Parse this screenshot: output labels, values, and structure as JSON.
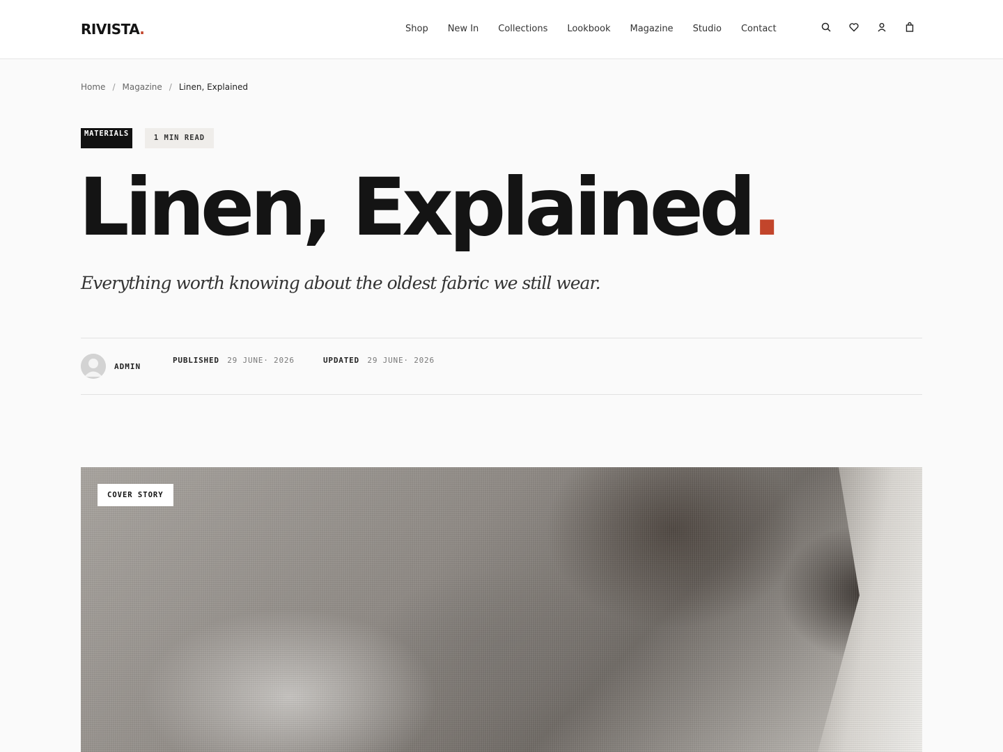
{
  "header": {
    "logo_text": "RIVISTA",
    "logo_dot": ".",
    "nav": [
      "Shop",
      "New In",
      "Collections",
      "Lookbook",
      "Magazine",
      "Studio",
      "Contact"
    ],
    "icons": [
      "search-icon",
      "heart-icon",
      "user-icon",
      "bag-icon"
    ]
  },
  "breadcrumb": {
    "items": [
      "Home",
      "Magazine",
      "Linen, Explained"
    ],
    "separator": "/"
  },
  "article": {
    "category": "MATERIALS",
    "read_time": "1 MIN READ",
    "title": "Linen, Explained",
    "title_dot": ".",
    "subtitle": "Everything worth knowing about the oldest fabric we still wear.",
    "author": "ADMIN",
    "published_label": "PUBLISHED",
    "published_date": "29 JUNE· 2026",
    "updated_label": "UPDATED",
    "updated_date": "29 JUNE· 2026",
    "cover_label": "COVER STORY"
  },
  "colors": {
    "accent": "#c2452b",
    "text": "#141414",
    "background": "#fafafa"
  }
}
